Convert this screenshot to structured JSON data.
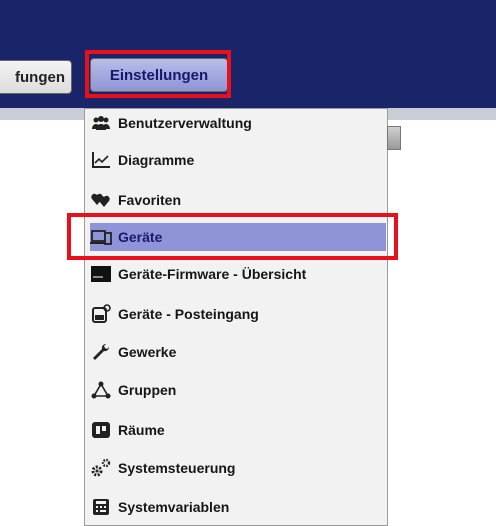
{
  "header": {
    "tabs": [
      {
        "label": "fungen"
      },
      {
        "label": "Einstellungen"
      }
    ]
  },
  "menu": {
    "items": [
      {
        "label": "Benutzerverwaltung",
        "icon": "users-icon"
      },
      {
        "label": "Diagramme",
        "icon": "line-chart-icon"
      },
      {
        "label": "Favoriten",
        "icon": "hearts-icon"
      },
      {
        "label": "Geräte",
        "icon": "devices-icon",
        "selected": true
      },
      {
        "label": "Geräte-Firmware - Übersicht",
        "icon": "firmware-icon"
      },
      {
        "label": "Geräte - Posteingang",
        "icon": "device-inbox-icon"
      },
      {
        "label": "Gewerke",
        "icon": "wrench-icon"
      },
      {
        "label": "Gruppen",
        "icon": "groups-icon"
      },
      {
        "label": "Räume",
        "icon": "rooms-icon"
      },
      {
        "label": "Systemsteuerung",
        "icon": "gears-icon"
      },
      {
        "label": "Systemvariablen",
        "icon": "calculator-icon"
      }
    ]
  },
  "colors": {
    "header_bg": "#1a2468",
    "active_tab": "#8f95d6",
    "selected_item": "#8f93d8",
    "highlight_red": "#e8101a"
  }
}
